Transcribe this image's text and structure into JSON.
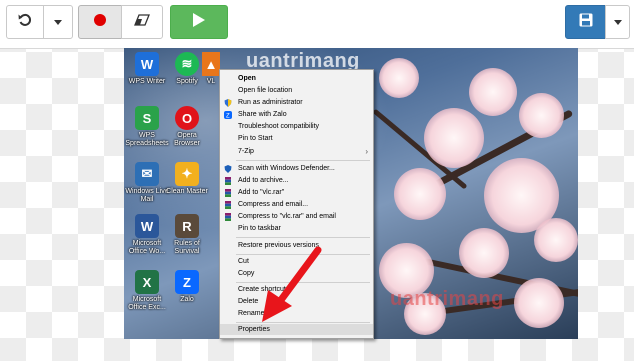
{
  "toolbar": {
    "undo_icon": "undo-icon",
    "record_icon": "record-dot-icon",
    "erase_icon": "eraser-icon",
    "play_icon": "play-icon",
    "save_icon": "floppy-disk-icon",
    "colors": {
      "record": "#e00000",
      "play": "#5cb85c",
      "save": "#337ab7"
    }
  },
  "desktop_icons": [
    {
      "label": "WPS Writer",
      "icon": "wps-writer-icon",
      "color": "#1e6fd9",
      "glyph": "W"
    },
    {
      "label": "Spotify",
      "icon": "spotify-icon",
      "color": "#1db954",
      "glyph": "≋"
    },
    {
      "label": "VL",
      "icon": "vlc-icon",
      "color": "#e8761b",
      "glyph": "▲"
    },
    {
      "label": "WPS Spreadsheets",
      "icon": "wps-spreadsheets-icon",
      "color": "#2aa24a",
      "glyph": "S"
    },
    {
      "label": "Opera Browser",
      "icon": "opera-icon",
      "color": "#e0131a",
      "glyph": "O"
    },
    {
      "label": "Windows Live Mail",
      "icon": "windows-live-mail-icon",
      "color": "#2d6fb5",
      "glyph": "✉"
    },
    {
      "label": "Clean Master",
      "icon": "clean-master-icon",
      "color": "#f2b01e",
      "glyph": "✦"
    },
    {
      "label": "Microsoft Office Wo...",
      "icon": "word-icon",
      "color": "#2b579a",
      "glyph": "W"
    },
    {
      "label": "Rules of Survival",
      "icon": "rules-of-survival-icon",
      "color": "#5a4a3a",
      "glyph": "R"
    },
    {
      "label": "Microsoft Office Exc...",
      "icon": "excel-icon",
      "color": "#217346",
      "glyph": "X"
    },
    {
      "label": "Zalo",
      "icon": "zalo-icon",
      "color": "#0a68ff",
      "glyph": "Z"
    }
  ],
  "context_menu": {
    "items": [
      {
        "label": "Open",
        "bold": true
      },
      {
        "label": "Open file location"
      },
      {
        "label": "Run as administrator",
        "icon": "shield-icon"
      },
      {
        "label": "Share with Zalo",
        "icon": "zalo-share-icon"
      },
      {
        "label": "Troubleshoot compatibility"
      },
      {
        "label": "Pin to Start"
      },
      {
        "label": "7-Zip",
        "submenu": true
      },
      {
        "label": "Scan with Windows Defender...",
        "icon": "defender-icon"
      },
      {
        "label": "Add to archive...",
        "icon": "winrar-icon"
      },
      {
        "label": "Add to \"vlc.rar\"",
        "icon": "winrar-icon"
      },
      {
        "label": "Compress and email...",
        "icon": "winrar-icon"
      },
      {
        "label": "Compress to \"vlc.rar\" and email",
        "icon": "winrar-icon"
      },
      {
        "label": "Pin to taskbar"
      },
      {
        "label": "Restore previous versions"
      },
      {
        "label": "Cut"
      },
      {
        "label": "Copy"
      },
      {
        "label": "Create shortcut"
      },
      {
        "label": "Delete"
      },
      {
        "label": "Rename"
      },
      {
        "label": "Properties",
        "highlighted": true
      }
    ],
    "submenu_arrow": "›"
  },
  "watermark": "uantrimang",
  "annotation": {
    "arrow_color": "#e8151b",
    "arrow_icon": "red-arrow-icon"
  }
}
